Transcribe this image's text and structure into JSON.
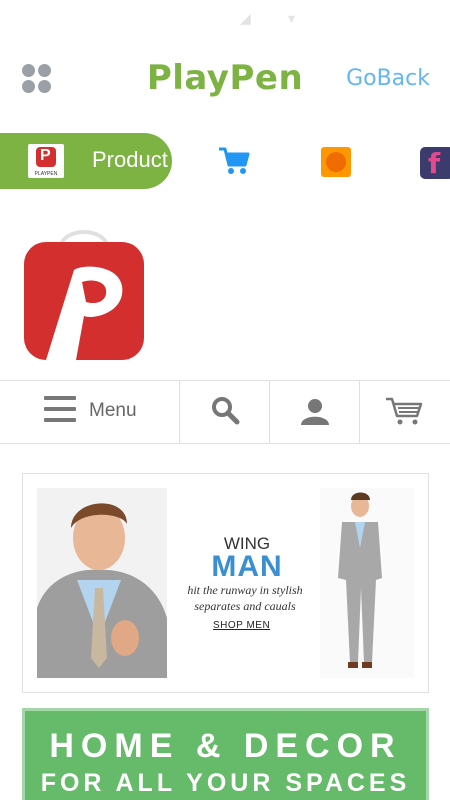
{
  "header": {
    "title": "PlayPen",
    "go_back": "GoBack",
    "title_color": "#7cb342",
    "link_color": "#64b5f6"
  },
  "tabs": {
    "active_label": "Product",
    "logo_caption": "PLAYPEN",
    "items": [
      {
        "icon": "cart-icon"
      },
      {
        "icon": "orange-app-icon"
      },
      {
        "icon": "facebook-icon",
        "glyph": "f"
      }
    ]
  },
  "nav": {
    "menu_label": "Menu",
    "icons": [
      "hamburger-icon",
      "search-icon",
      "user-icon",
      "cart-icon"
    ]
  },
  "banner_wingman": {
    "line1": "WING",
    "line2": "MAN",
    "tagline_line1": "hit the runway in stylish",
    "tagline_line2": "separates and cauals",
    "cta": "SHOP MEN"
  },
  "banner_home": {
    "line1": "HOME & DECOR",
    "line2": "FOR ALL YOUR SPACES",
    "color": "#66bb6a"
  }
}
